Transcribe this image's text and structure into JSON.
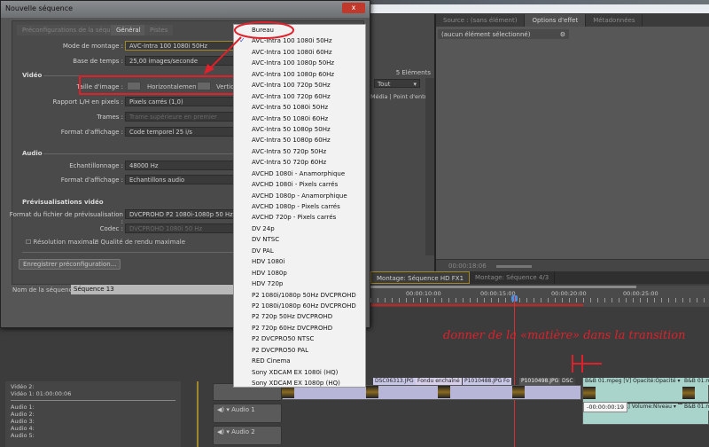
{
  "dialog": {
    "title": "Nouvelle séquence",
    "close": "x",
    "tabs": [
      "Préconfigurations de la séquence",
      "Général",
      "Pistes"
    ],
    "mode_label": "Mode de montage :",
    "mode_value": "AVC-Intra 100 1080i 50Hz",
    "timebase_label": "Base de temps :",
    "timebase_value": "25,00 images/seconde",
    "video_section": "Vidéo",
    "frame_label": "Taille d'image :",
    "horiz": "Horizontalement",
    "vert": "Verticalement",
    "par_label": "Rapport L/H en pixels :",
    "par_value": "Pixels carrés (1,0)",
    "fields_label": "Trames :",
    "fields_value": "Trame supérieure en premier",
    "display_label": "Format d'affichage :",
    "display_value": "Code temporel 25 i/s",
    "audio_section": "Audio",
    "sample_label": "Echantillonnage :",
    "sample_value": "48000 Hz",
    "adisplay_label": "Format d'affichage :",
    "adisplay_value": "Echantillons audio",
    "preview_section": "Prévisualisations vidéo",
    "pformat_label": "Format du fichier de prévisualisation :",
    "pformat_value": "DVCPROHD P2 1080i-1080p 50 Hz",
    "codec_label": "Codec :",
    "codec_value": "DVCPROHD 1080i 50 Hz",
    "maxres": "Résolution maximale",
    "maxquality": "Qualité de rendu maximale",
    "save_preset": "Enregistrer préconfiguration...",
    "seqname_label": "Nom de la séquence :",
    "seqname_value": "Séquence 13"
  },
  "dropdown": {
    "selected": 1,
    "check": "✓",
    "items": [
      "Bureau",
      "AVC-Intra 100 1080i 50Hz",
      "AVC-Intra 100 1080i 60Hz",
      "AVC-Intra 100 1080p 50Hz",
      "AVC-Intra 100 1080p 60Hz",
      "AVC-Intra 100 720p 50Hz",
      "AVC-Intra 100 720p 60Hz",
      "AVC-Intra 50 1080i 50Hz",
      "AVC-Intra 50 1080i 60Hz",
      "AVC-Intra 50 1080p 50Hz",
      "AVC-Intra 50 1080p 60Hz",
      "AVC-Intra 50 720p 50Hz",
      "AVC-Intra 50 720p 60Hz",
      "AVCHD 1080i - Anamorphique",
      "AVCHD 1080i - Pixels carrés",
      "AVCHD 1080p - Anamorphique",
      "AVCHD 1080p - Pixels carrés",
      "AVCHD 720p - Pixels carrés",
      "DV 24p",
      "DV NTSC",
      "DV PAL",
      "HDV 1080i",
      "HDV 1080p",
      "HDV 720p",
      "P2 1080i/1080p 50Hz DVCPROHD",
      "P2 1080i/1080p 60Hz DVCPROHD",
      "P2 720p 50Hz DVCPROHD",
      "P2 720p 60Hz DVCPROHD",
      "P2 DVCPRO50 NTSC",
      "P2 DVCPRO50 PAL",
      "RED Cinema",
      "Sony XDCAM EX 1080i (HQ)",
      "Sony XDCAM EX 1080p (HQ)"
    ]
  },
  "right_panel": {
    "tabs": [
      "Source : (sans élément)",
      "Options d'effet",
      "Métadonnées"
    ],
    "no_selection": "(aucun élément sélectionné)",
    "timecode": "00:00:18:06"
  },
  "project": {
    "count": "5 Eléments",
    "filter": "Tout",
    "col1": "Média",
    "col2": "Point d'entrée"
  },
  "timeline": {
    "tabs": [
      "Montage: Séquence HD FX1",
      "Montage: Séquence 4/3"
    ],
    "ticks": [
      "00:00:10:00",
      "00:00:15:00",
      "00:00:20:00",
      "00:00:25:00"
    ],
    "annotation": "donner de la «matière» dans la transition",
    "clips": [
      "DSC06313.JPG",
      "Fondu enchaîné",
      "P1010488.JPG",
      "Fo",
      "P1010498.JPG",
      "DSC",
      "B&B 01.mpeg [V]  Opacité:Opacité ▾",
      "B&B 01.mp"
    ],
    "audio_clip": "[A] Volume:Niveau ▾",
    "audio_clip2": "B&B 01.mp",
    "tooltip": "-00:00:00:19",
    "tracks": [
      "Audio 1",
      "Audio 2"
    ]
  },
  "meters": {
    "lines": [
      "Vidéo 2:",
      "Vidéo 1: 01:00:00:06"
    ],
    "audio": [
      "Audio 1:",
      "Audio 2:",
      "Audio 3:",
      "Audio 4:",
      "Audio 5:"
    ]
  },
  "colors": {
    "annotation": "#e0202a",
    "clip": "#b7b5d8",
    "clip_av": "#a9d4cc"
  }
}
